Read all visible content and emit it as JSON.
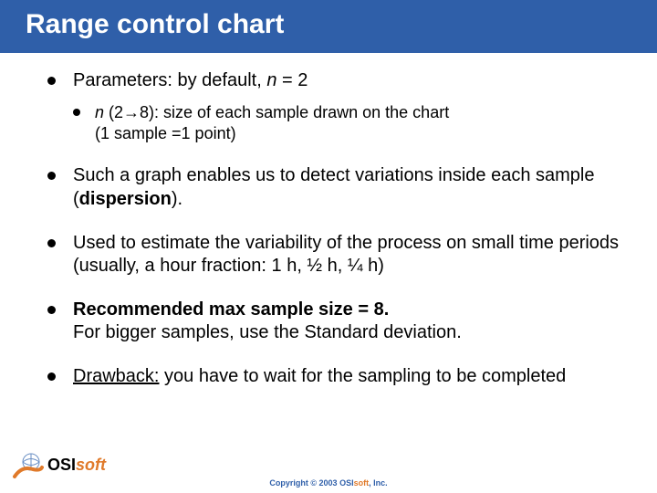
{
  "title": "Range control chart",
  "bullets": {
    "b1": {
      "pre": "Parameters: by default, ",
      "var": "n",
      "post": " = 2",
      "sub": {
        "var": "n",
        "range": " (2→8): size of each sample drawn on the chart",
        "line2": "(1 sample =1 point)"
      }
    },
    "b2": {
      "pre": "Such a graph enables us to detect variations inside each sample (",
      "bold": "dispersion",
      "post": ")."
    },
    "b3": "Used to estimate the variability of the process on small time periods (usually, a hour fraction: 1 h, ½ h, ¼ h)",
    "b4": {
      "bold": "Recommended max sample size = 8.",
      "line2": "For bigger samples, use the Standard deviation."
    },
    "b5": {
      "under": "Drawback:",
      "rest": " you have to wait for the sampling to be completed"
    }
  },
  "footer": {
    "part1": "Copyright © 2003 ",
    "part2": "OSI",
    "part3": "soft",
    "part4": ", Inc."
  },
  "logo": {
    "part1": "OSI",
    "part2": "soft"
  }
}
